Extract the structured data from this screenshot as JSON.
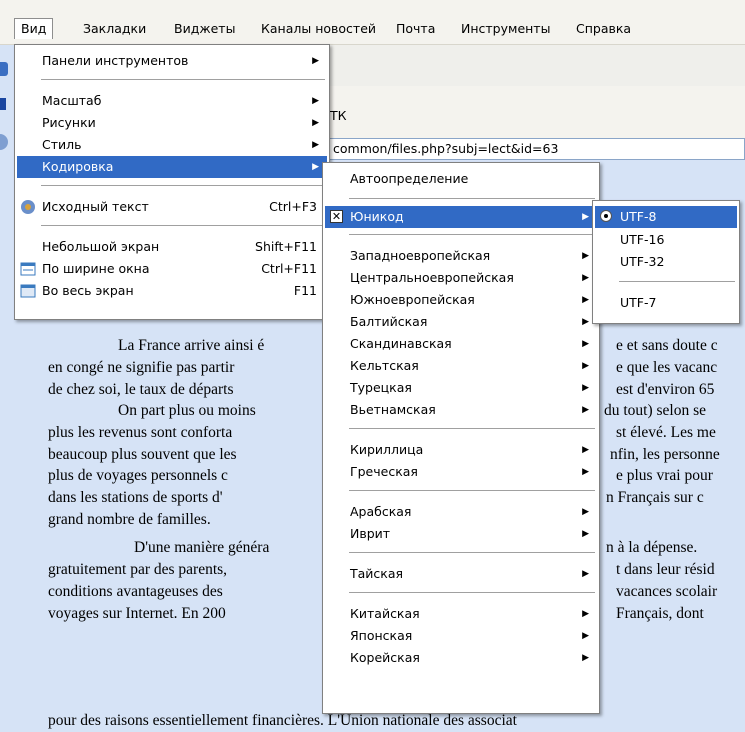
{
  "menubar": [
    "Вид",
    "Закладки",
    "Виджеты",
    "Каналы новостей",
    "Почта",
    "Инструменты",
    "Справка"
  ],
  "tab_label": "ТК",
  "address": "common/files.php?subj=lect&id=63",
  "view_menu": {
    "toolbars": "Панели инструментов",
    "zoom": "Масштаб",
    "images": "Рисунки",
    "style": "Стиль",
    "encoding": "Кодировка",
    "source": "Исходный текст",
    "source_sc": "Ctrl+F3",
    "small_screen": "Небольшой экран",
    "small_screen_sc": "Shift+F11",
    "fit_width": "По ширине окна",
    "fit_width_sc": "Ctrl+F11",
    "fullscreen": "Во весь экран",
    "fullscreen_sc": "F11"
  },
  "encoding_menu": {
    "auto": "Автоопределение",
    "unicode": "Юникод",
    "western": "Западноевропейская",
    "central": "Центральноевропейская",
    "southern": "Южноевропейская",
    "baltic": "Балтийская",
    "nordic": "Скандинавская",
    "celtic": "Кельтская",
    "turkish": "Турецкая",
    "vietnamese": "Вьетнамская",
    "cyrillic": "Кириллица",
    "greek": "Греческая",
    "arabic": "Арабская",
    "hebrew": "Иврит",
    "thai": "Тайская",
    "chinese": "Китайская",
    "japanese": "Японская",
    "korean": "Корейская"
  },
  "unicode_menu": {
    "utf8": "UTF-8",
    "utf16": "UTF-16",
    "utf32": "UTF-32",
    "utf7": "UTF-7"
  },
  "text_lines": {
    "l1a": "La France arrive ainsi é",
    "l1b": "e et sans doute c",
    "l2a": "en congé ne signifie pas partir",
    "l2b": "e que les vacanc",
    "l3a": "de chez soi, le taux de départs",
    "l3b": "est d'environ 65",
    "l4a": "On part plus ou moins",
    "l4b": "du tout) selon se",
    "l5a": "plus les revenus sont conforta",
    "l5b": "st élevé. Les me",
    "l6a": "beaucoup plus souvent que les",
    "l6b": "nfin, les personne",
    "l7a": "plus de voyages personnels c",
    "l7b": "e plus vrai pour",
    "l8a": "dans les stations de sports d'",
    "l8b": "n Français sur c",
    "l9a": "grand nombre de familles.",
    "l10a": "D'une manière généra",
    "l10b": "n à la dépense.",
    "l11a": "gratuitement par des parents,",
    "l11b": "t dans leur résid",
    "l12a": "conditions avantageuses des",
    "l12b": "vacances scolair",
    "l13a": "voyages sur Internet. En 200",
    "l13b": "Français, dont",
    "l14a": "pour des raisons essentiellement financières. L'Union nationale des associat"
  }
}
